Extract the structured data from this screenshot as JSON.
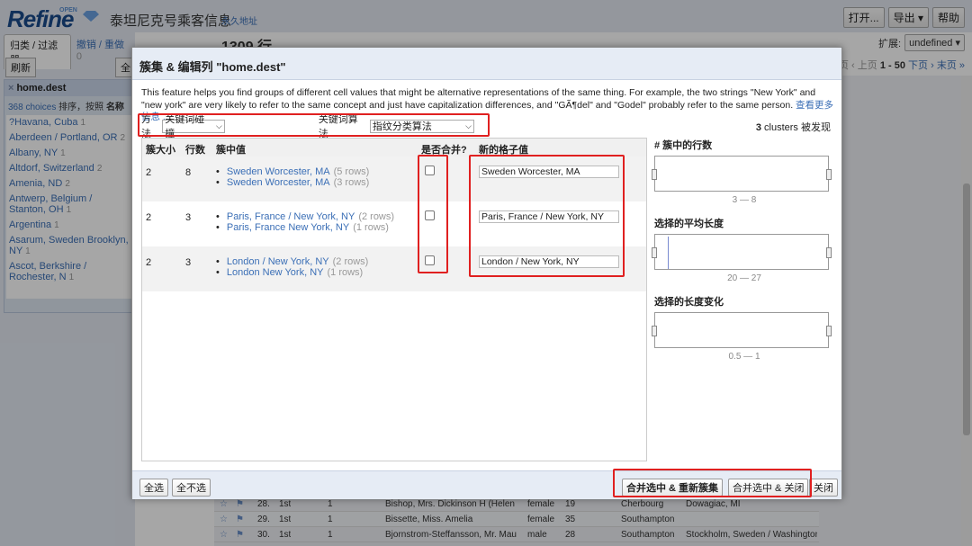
{
  "app": {
    "logo": "Refine",
    "logo_tag": "OPEN",
    "project_title": "泰坦尼克号乘客信息",
    "permalink": "永久地址",
    "buttons": {
      "open": "打开...",
      "export": "导出 ▾",
      "help": "帮助"
    }
  },
  "left_panel": {
    "tab_facets": "归类 / 过滤器",
    "tab_undo": "撤销 / 重做",
    "undo_count": "0",
    "refresh": "刷新",
    "select_all": "全",
    "facet": {
      "close": "×",
      "title": "home.dest",
      "choices": "368 choices",
      "sort_label": "排序，按照",
      "sort_name": "名称",
      "items": [
        {
          "name": "?Havana, Cuba",
          "count": "1"
        },
        {
          "name": "Aberdeen / Portland, OR",
          "count": "2"
        },
        {
          "name": "Albany, NY",
          "count": "1"
        },
        {
          "name": "Altdorf, Switzerland",
          "count": "2"
        },
        {
          "name": "Amenia, ND",
          "count": "2"
        },
        {
          "name": "Antwerp, Belgium / Stanton, OH",
          "count": "1"
        },
        {
          "name": "Argentina",
          "count": "1"
        },
        {
          "name": "Asarum, Sweden Brooklyn, NY",
          "count": "1"
        },
        {
          "name": "Ascot, Berkshire / Rochester, N",
          "count": "1"
        }
      ]
    }
  },
  "main": {
    "row_count": "1309 行",
    "expand_label": "扩展:",
    "expand_value": "undefined ▾",
    "pager": {
      "prev": "« 首页 ‹ 上页",
      "range": "1 - 50",
      "next": "下页 › 末页 »"
    },
    "rows": [
      {
        "num": "28.",
        "cls": "1st",
        "surv": "1",
        "name": "Bishop, Mrs. Dickinson H (Helen",
        "sex": "female",
        "age": "19",
        "emb": "Cherbourg",
        "dest": "Dowagiac, MI"
      },
      {
        "num": "29.",
        "cls": "1st",
        "surv": "1",
        "name": "Bissette, Miss. Amelia",
        "sex": "female",
        "age": "35",
        "emb": "Southampton",
        "dest": ""
      },
      {
        "num": "30.",
        "cls": "1st",
        "surv": "1",
        "name": "Bjornstrom-Steffansson, Mr. Mau",
        "sex": "male",
        "age": "28",
        "emb": "Southampton",
        "dest": "Stockholm, Sweden / Washington,"
      }
    ]
  },
  "dialog": {
    "title": "簇集 & 编辑列 \"home.dest\"",
    "description": "This feature helps you find groups of different cell values that might be alternative representations of the same thing. For example, the two strings \"New York\" and \"new york\" are very likely to refer to the same concept and just have capitalization differences, and \"GÃ¶del\" and \"Godel\" probably refer to the same person.",
    "more_info": "查看更多信息 ...",
    "method_label": "方法",
    "method_value": "关键词碰撞",
    "keying_label": "关键词算法",
    "keying_value": "指纹分类算法",
    "clusters_count": "3",
    "clusters_text": "clusters 被发现",
    "table_headers": {
      "size": "簇大小",
      "rows": "行数",
      "values": "簇中值",
      "merge": "是否合并?",
      "new_value": "新的格子值"
    },
    "clusters": [
      {
        "size": "2",
        "rows": "8",
        "values": [
          {
            "v": "Sweden Worcester, MA",
            "rc": "(5 rows)"
          },
          {
            "v": "Sweden Worcester, MA",
            "rc": "(3 rows)"
          }
        ],
        "new_value": "Sweden Worcester, MA"
      },
      {
        "size": "2",
        "rows": "3",
        "values": [
          {
            "v": "Paris, France / New York, NY",
            "rc": "(2 rows)"
          },
          {
            "v": "Paris, France New York, NY",
            "rc": "(1 rows)"
          }
        ],
        "new_value": "Paris, France / New York, NY"
      },
      {
        "size": "2",
        "rows": "3",
        "values": [
          {
            "v": "London / New York, NY",
            "rc": "(2 rows)"
          },
          {
            "v": "London New York, NY",
            "rc": "(1 rows)"
          }
        ],
        "new_value": "London / New York, NY"
      }
    ],
    "side": {
      "rows_title": "# 簇中的行数",
      "rows_range": "3 — 8",
      "avg_len_title": "选择的平均长度",
      "avg_len_range": "20 — 27",
      "len_var_title": "选择的长度变化",
      "len_var_range": "0.5 — 1"
    },
    "footer": {
      "select_all": "全选",
      "deselect_all": "全不选",
      "merge_recluster": "合并选中 & 重新簇集",
      "merge_close": "合并选中 & 关闭",
      "close": "关闭"
    }
  },
  "colors": {
    "highlight": "#e02020",
    "link": "#3b6fb6",
    "header_bg": "#e3e9f2"
  }
}
